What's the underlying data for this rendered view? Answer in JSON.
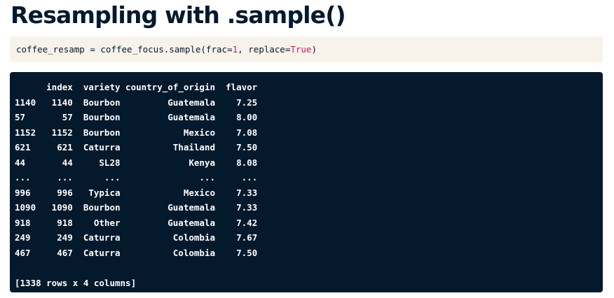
{
  "page": {
    "title": "Resampling with .sample()"
  },
  "code": {
    "prefix": "coffee_resamp = coffee_focus.sample(frac=",
    "frac_value": "1",
    "middle": ", replace=",
    "replace_value": "True",
    "suffix": ")"
  },
  "output": {
    "header": "      index  variety country_of_origin  flavor",
    "rows": [
      "1140   1140  Bourbon         Guatemala    7.25",
      "57       57  Bourbon         Guatemala    8.00",
      "1152   1152  Bourbon            Mexico    7.08",
      "621     621  Caturra          Thailand    7.50",
      "44       44     SL28             Kenya    8.08",
      "...     ...      ...               ...     ...",
      "996     996   Typica            Mexico    7.33",
      "1090   1090  Bourbon         Guatemala    7.33",
      "918     918    Other         Guatemala    7.42",
      "249     249  Caturra          Colombia    7.67",
      "467     467  Caturra          Colombia    7.50"
    ],
    "summary": "[1338 rows x 4 columns]"
  }
}
